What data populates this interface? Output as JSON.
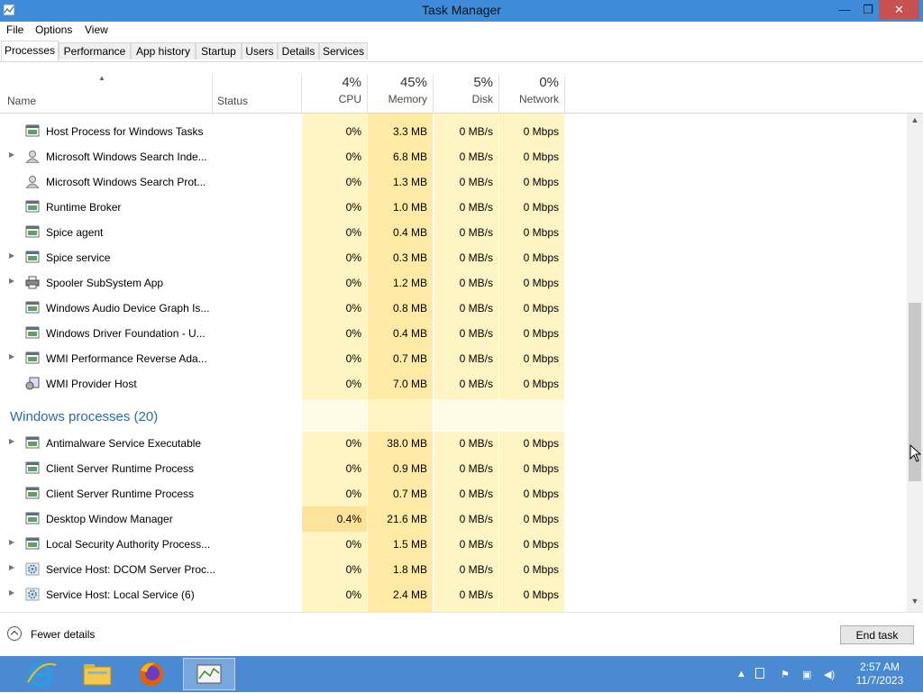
{
  "window": {
    "title": "Task Manager",
    "minimize": "—",
    "restore": "❐",
    "close": "✕"
  },
  "menu": [
    "File",
    "Options",
    "View"
  ],
  "tabs": [
    "Processes",
    "Performance",
    "App history",
    "Startup",
    "Users",
    "Details",
    "Services"
  ],
  "active_tab": "Processes",
  "columns": {
    "name": "Name",
    "status": "Status",
    "cpu": {
      "pct": "4%",
      "label": "CPU"
    },
    "memory": {
      "pct": "45%",
      "label": "Memory"
    },
    "disk": {
      "pct": "5%",
      "label": "Disk"
    },
    "network": {
      "pct": "0%",
      "label": "Network"
    }
  },
  "background_rows": [
    {
      "name": "Host Process for Windows Tasks",
      "expand": false,
      "icon": "service-window-icon",
      "cpu": "0%",
      "memory": "3.3 MB",
      "disk": "0 MB/s",
      "network": "0 Mbps"
    },
    {
      "name": "Microsoft Windows Search Inde...",
      "expand": true,
      "icon": "search-user-icon",
      "cpu": "0%",
      "memory": "6.8 MB",
      "disk": "0 MB/s",
      "network": "0 Mbps"
    },
    {
      "name": "Microsoft Windows Search Prot...",
      "expand": false,
      "icon": "search-user-icon",
      "cpu": "0%",
      "memory": "1.3 MB",
      "disk": "0 MB/s",
      "network": "0 Mbps"
    },
    {
      "name": "Runtime Broker",
      "expand": false,
      "icon": "service-window-icon",
      "cpu": "0%",
      "memory": "1.0 MB",
      "disk": "0 MB/s",
      "network": "0 Mbps"
    },
    {
      "name": "Spice agent",
      "expand": false,
      "icon": "service-window-icon",
      "cpu": "0%",
      "memory": "0.4 MB",
      "disk": "0 MB/s",
      "network": "0 Mbps"
    },
    {
      "name": "Spice service",
      "expand": true,
      "icon": "service-window-icon",
      "cpu": "0%",
      "memory": "0.3 MB",
      "disk": "0 MB/s",
      "network": "0 Mbps"
    },
    {
      "name": "Spooler SubSystem App",
      "expand": true,
      "icon": "printer-icon",
      "cpu": "0%",
      "memory": "1.2 MB",
      "disk": "0 MB/s",
      "network": "0 Mbps"
    },
    {
      "name": "Windows Audio Device Graph Is...",
      "expand": false,
      "icon": "service-window-icon",
      "cpu": "0%",
      "memory": "0.8 MB",
      "disk": "0 MB/s",
      "network": "0 Mbps"
    },
    {
      "name": "Windows Driver Foundation - U...",
      "expand": false,
      "icon": "service-window-icon",
      "cpu": "0%",
      "memory": "0.4 MB",
      "disk": "0 MB/s",
      "network": "0 Mbps"
    },
    {
      "name": "WMI Performance Reverse Ada...",
      "expand": true,
      "icon": "service-window-icon",
      "cpu": "0%",
      "memory": "0.7 MB",
      "disk": "0 MB/s",
      "network": "0 Mbps"
    },
    {
      "name": "WMI Provider Host",
      "expand": false,
      "icon": "wmi-host-icon",
      "cpu": "0%",
      "memory": "7.0 MB",
      "disk": "0 MB/s",
      "network": "0 Mbps"
    }
  ],
  "windows_group_title": "Windows processes (20)",
  "windows_rows": [
    {
      "name": "Antimalware Service Executable",
      "expand": true,
      "icon": "service-window-icon",
      "cpu": "0%",
      "memory": "38.0 MB",
      "disk": "0 MB/s",
      "network": "0 Mbps"
    },
    {
      "name": "Client Server Runtime Process",
      "expand": false,
      "icon": "service-window-icon",
      "cpu": "0%",
      "memory": "0.9 MB",
      "disk": "0 MB/s",
      "network": "0 Mbps"
    },
    {
      "name": "Client Server Runtime Process",
      "expand": false,
      "icon": "service-window-icon",
      "cpu": "0%",
      "memory": "0.7 MB",
      "disk": "0 MB/s",
      "network": "0 Mbps"
    },
    {
      "name": "Desktop Window Manager",
      "expand": false,
      "icon": "service-window-icon",
      "cpu": "0.4%",
      "memory": "21.6 MB",
      "disk": "0 MB/s",
      "network": "0 Mbps",
      "cpu_hot": true
    },
    {
      "name": "Local Security Authority Process...",
      "expand": true,
      "icon": "service-window-icon",
      "cpu": "0%",
      "memory": "1.5 MB",
      "disk": "0 MB/s",
      "network": "0 Mbps"
    },
    {
      "name": "Service Host: DCOM Server Proc...",
      "expand": true,
      "icon": "gear-icon",
      "cpu": "0%",
      "memory": "1.8 MB",
      "disk": "0 MB/s",
      "network": "0 Mbps"
    },
    {
      "name": "Service Host: Local Service (6)",
      "expand": true,
      "icon": "gear-icon",
      "cpu": "0%",
      "memory": "2.4 MB",
      "disk": "0 MB/s",
      "network": "0 Mbps"
    }
  ],
  "footer": {
    "fewer_details": "Fewer details",
    "end_task": "End task"
  },
  "taskbar": {
    "apps": [
      "internet-explorer-icon",
      "file-explorer-icon",
      "firefox-icon",
      "task-manager-icon"
    ],
    "time": "2:57 AM",
    "date": "11/7/2023"
  },
  "colors": {
    "title_bar": "#3d8bd9",
    "cpu_col": "#fff4c4",
    "mem_col": "#ffeaa6",
    "group_text": "#2a6ba8",
    "taskbar": "#4a8ad2"
  }
}
